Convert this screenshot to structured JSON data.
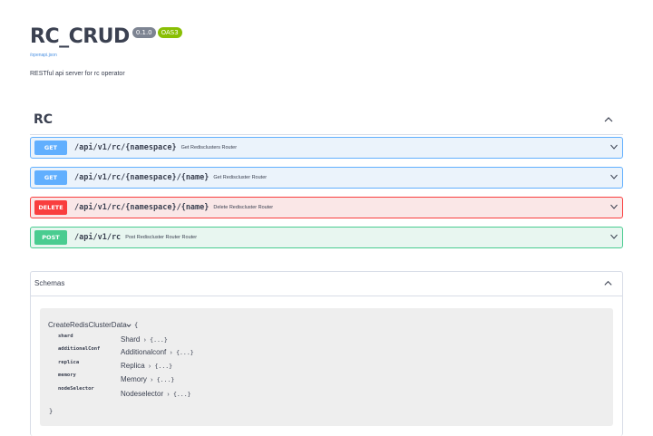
{
  "header": {
    "title": "RC_CRUD",
    "version_badge": "0.1.0",
    "oas_badge": "OAS3",
    "spec_link": "/openapi.json",
    "description": "RESTful api server for rc operator"
  },
  "section": {
    "title": "RC",
    "operations": [
      {
        "method": "GET",
        "path": "/api/v1/rc/{namespace}",
        "summary": "Get Redisclusters Router"
      },
      {
        "method": "GET",
        "path": "/api/v1/rc/{namespace}/{name}",
        "summary": "Get Rediscluster Router"
      },
      {
        "method": "DELETE",
        "path": "/api/v1/rc/{namespace}/{name}",
        "summary": "Delete Rediscluster Router"
      },
      {
        "method": "POST",
        "path": "/api/v1/rc",
        "summary": "Post Rediscluster Router Router"
      }
    ]
  },
  "schemas": {
    "title": "Schemas",
    "model": {
      "name": "CreateRedisClusterData",
      "open_brace": "{",
      "close_brace": "}",
      "properties": [
        {
          "name": "shard",
          "type": "Shard",
          "arrow": "›",
          "value": "{...}"
        },
        {
          "name": "additionalConf",
          "type": "Additionalconf",
          "arrow": "›",
          "value": "{...}"
        },
        {
          "name": "replica",
          "type": "Replica",
          "arrow": "›",
          "value": "{...}"
        },
        {
          "name": "memory",
          "type": "Memory",
          "arrow": "›",
          "value": "{...}"
        },
        {
          "name": "nodeSelector",
          "type": "Nodeselector",
          "arrow": "›",
          "value": "{...}"
        }
      ]
    }
  },
  "colors": {
    "get": "#61affe",
    "delete": "#f93e3e",
    "post": "#49cc90",
    "text": "#3b4151",
    "link": "#4990e2"
  },
  "icons": {
    "collapse": "chevron-up-icon",
    "expand": "chevron-down-icon"
  }
}
